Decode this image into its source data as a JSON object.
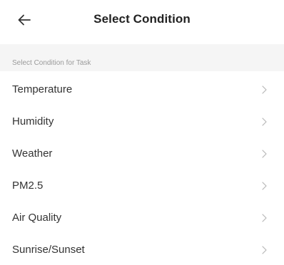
{
  "header": {
    "back_icon": "arrow-left-icon",
    "title": "Select Condition"
  },
  "section": {
    "label": "Select Condition for Task"
  },
  "conditions": [
    {
      "label": "Temperature",
      "icon": "chevron-right-icon"
    },
    {
      "label": "Humidity",
      "icon": "chevron-right-icon"
    },
    {
      "label": "Weather",
      "icon": "chevron-right-icon"
    },
    {
      "label": "PM2.5",
      "icon": "chevron-right-icon"
    },
    {
      "label": "Air Quality",
      "icon": "chevron-right-icon"
    },
    {
      "label": "Sunrise/Sunset",
      "icon": "chevron-right-icon"
    }
  ],
  "colors": {
    "background": "#ffffff",
    "section_background": "#f5f5f5",
    "text": "#333333",
    "muted_text": "#9a9a9a",
    "chevron": "#b8b8b8"
  }
}
